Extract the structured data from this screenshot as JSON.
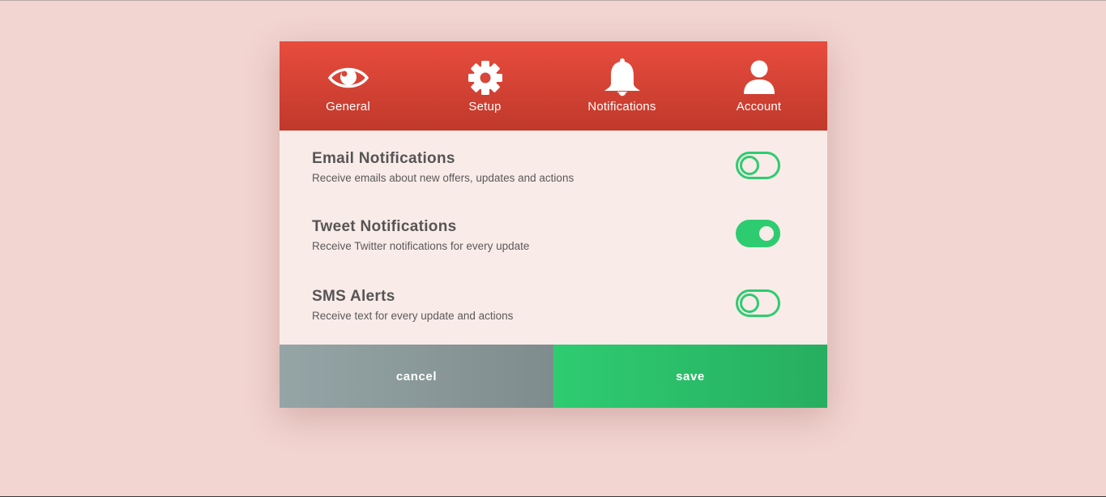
{
  "tabs": [
    {
      "label": "General",
      "icon": "eye-icon"
    },
    {
      "label": "Setup",
      "icon": "gear-icon"
    },
    {
      "label": "Notifications",
      "icon": "bell-icon"
    },
    {
      "label": "Account",
      "icon": "user-icon"
    }
  ],
  "settings": [
    {
      "title": "Email Notifications",
      "description": "Receive emails about new offers, updates and actions",
      "enabled": false
    },
    {
      "title": "Tweet Notifications",
      "description": "Receive Twitter notifications for every update",
      "enabled": true
    },
    {
      "title": "SMS Alerts",
      "description": "Receive text for every update and actions",
      "enabled": false
    }
  ],
  "footer": {
    "cancel_label": "cancel",
    "save_label": "save"
  },
  "colors": {
    "header": "#e74c3c",
    "accent": "#2ecc71",
    "cancel": "#95a5a6",
    "background": "#f2d4d0"
  }
}
